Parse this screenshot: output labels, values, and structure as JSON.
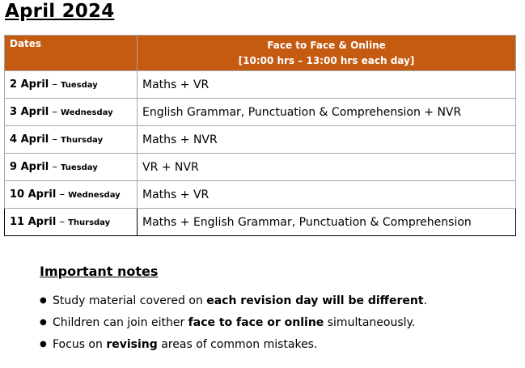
{
  "title": "April 2024",
  "table": {
    "header_dates": "Dates",
    "header_line1": "Face to Face & Online",
    "header_line2": "[10:00 hrs – 13:00 hrs each day]",
    "header_color": "#c55a11",
    "rows": [
      {
        "date": "2 April",
        "sep": " – ",
        "day": "Tuesday",
        "subject": "Maths + VR"
      },
      {
        "date": "3 April",
        "sep": " – ",
        "day": "Wednesday",
        "subject": "English Grammar, Punctuation & Comprehension + NVR"
      },
      {
        "date": "4 April",
        "sep": " – ",
        "day": "Thursday",
        "subject": "Maths + NVR"
      },
      {
        "date": "9 April",
        "sep": " – ",
        "day": "Tuesday",
        "subject": "VR + NVR"
      },
      {
        "date": "10 April",
        "sep": " – ",
        "day": "Wednesday",
        "subject": "Maths + VR"
      },
      {
        "date": "11 April",
        "sep": " – ",
        "day": "Thursday",
        "subject": "Maths + English Grammar, Punctuation & Comprehension"
      }
    ]
  },
  "notes": {
    "title": "Important notes",
    "items": [
      {
        "pre": "Study material covered on ",
        "bold": "each revision day will be different",
        "post": "."
      },
      {
        "pre": "Children can join either ",
        "bold": "face to face or online",
        "post": " simultaneously."
      },
      {
        "pre": "Focus on ",
        "bold": "revising",
        "post": " areas of common mistakes."
      }
    ]
  }
}
